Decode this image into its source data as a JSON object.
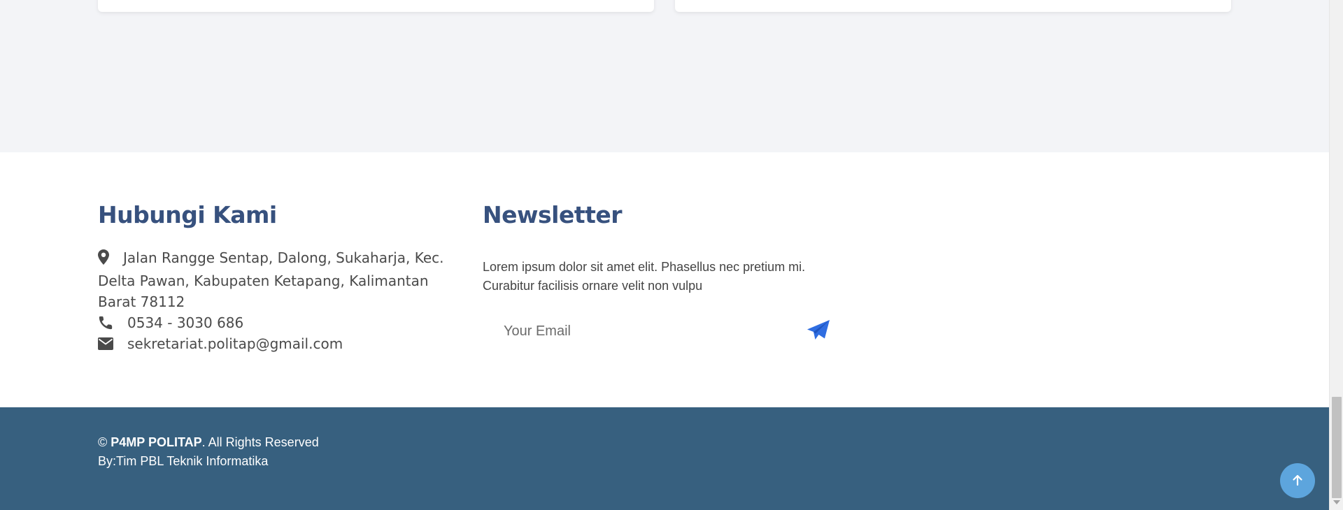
{
  "contact": {
    "title": "Hubungi Kami",
    "address": "Jalan Rangge Sentap, Dalong, Sukaharja, Kec. Delta Pawan, Kabupaten Ketapang, Kalimantan Barat 78112",
    "phone": "0534 - 3030 686",
    "email": "sekretariat.politap@gmail.com",
    "icons": [
      "map-marker-icon",
      "phone-icon",
      "envelope-icon"
    ]
  },
  "newsletter": {
    "title": "Newsletter",
    "description": "Lorem ipsum dolor sit amet elit. Phasellus nec pretium mi. Curabitur facilisis ornare velit non vulpu",
    "email_placeholder": "Your Email",
    "submit_icon": "paper-plane-icon"
  },
  "footer": {
    "copyright_symbol": "©",
    "brand": "P4MP POLITAP",
    "rights": ". All Rights Reserved",
    "credit": "By:Tim PBL Teknik Informatika",
    "back_to_top_icon": "arrow-up-icon"
  },
  "colors": {
    "heading": "#37517e",
    "footer_bg": "#37607f",
    "accent_send": "#2f6de1",
    "back_to_top_bg": "#5da5dd",
    "page_bg": "#f3f4f7"
  }
}
